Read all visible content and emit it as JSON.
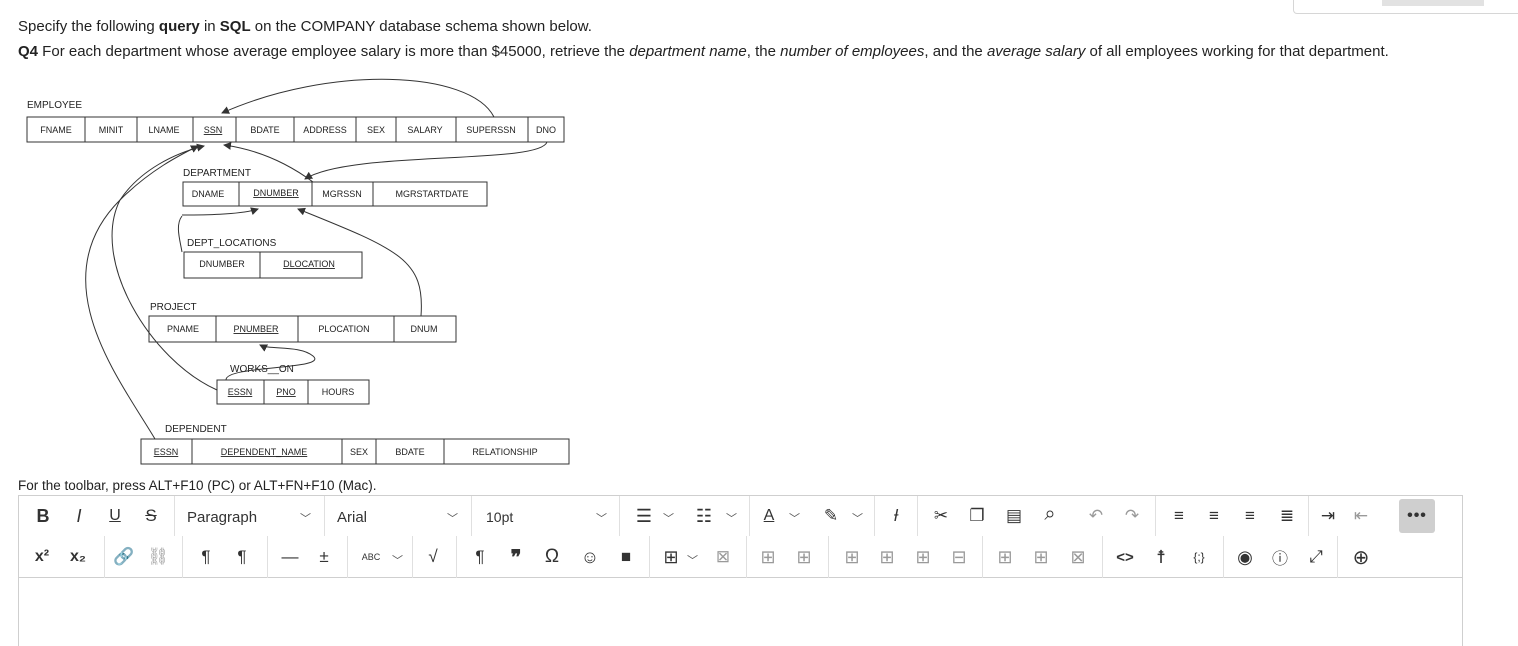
{
  "question": {
    "line1_prefix": "Specify the following ",
    "line1_query": "query",
    "line1_mid": " in ",
    "line1_sql": "SQL",
    "line1_suffix": " on the COMPANY database schema shown below.",
    "q_label": "Q4",
    "q_a": " For each department whose average employee salary is more than $45000, retrieve the ",
    "q_dept_name": "department name",
    "q_b": ", the ",
    "q_num_emp": "number of employees",
    "q_c": ", and the ",
    "q_avg_sal": "average salary",
    "q_d": " of all employees working for that department."
  },
  "schema": {
    "employee": {
      "title": "EMPLOYEE",
      "cols": [
        "FNAME",
        "MINIT",
        "LNAME",
        "SSN",
        "BDATE",
        "ADDRESS",
        "SEX",
        "SALARY",
        "SUPERSSN",
        "DNO"
      ]
    },
    "department": {
      "title": "DEPARTMENT",
      "cols": [
        "DNAME",
        "DNUMBER",
        "MGRSSN",
        "MGRSTARTDATE"
      ]
    },
    "dept_locations": {
      "title": "DEPT_LOCATIONS",
      "cols": [
        "DNUMBER",
        "DLOCATION"
      ]
    },
    "project": {
      "title": "PROJECT",
      "cols": [
        "PNAME",
        "PNUMBER",
        "PLOCATION",
        "DNUM"
      ]
    },
    "works_on": {
      "title": "WORKS__ON",
      "cols": [
        "ESSN",
        "PNO",
        "HOURS"
      ]
    },
    "dependent": {
      "title": "DEPENDENT",
      "cols": [
        "ESSN",
        "DEPENDENT_NAME",
        "SEX",
        "BDATE",
        "RELATIONSHIP"
      ]
    }
  },
  "editor": {
    "hint": "For the toolbar, press ALT+F10 (PC) or ALT+FN+F10 (Mac).",
    "block_format": "Paragraph",
    "font_family": "Arial",
    "font_size": "10pt",
    "bold": "B",
    "italic": "I",
    "underline": "U",
    "strike": "S",
    "superscript": "x²",
    "subscript": "x₂",
    "more": "•••",
    "spellcheck_label": "ABC",
    "code_label": "<>",
    "html_label": "{;}",
    "text_color_label": "A"
  }
}
